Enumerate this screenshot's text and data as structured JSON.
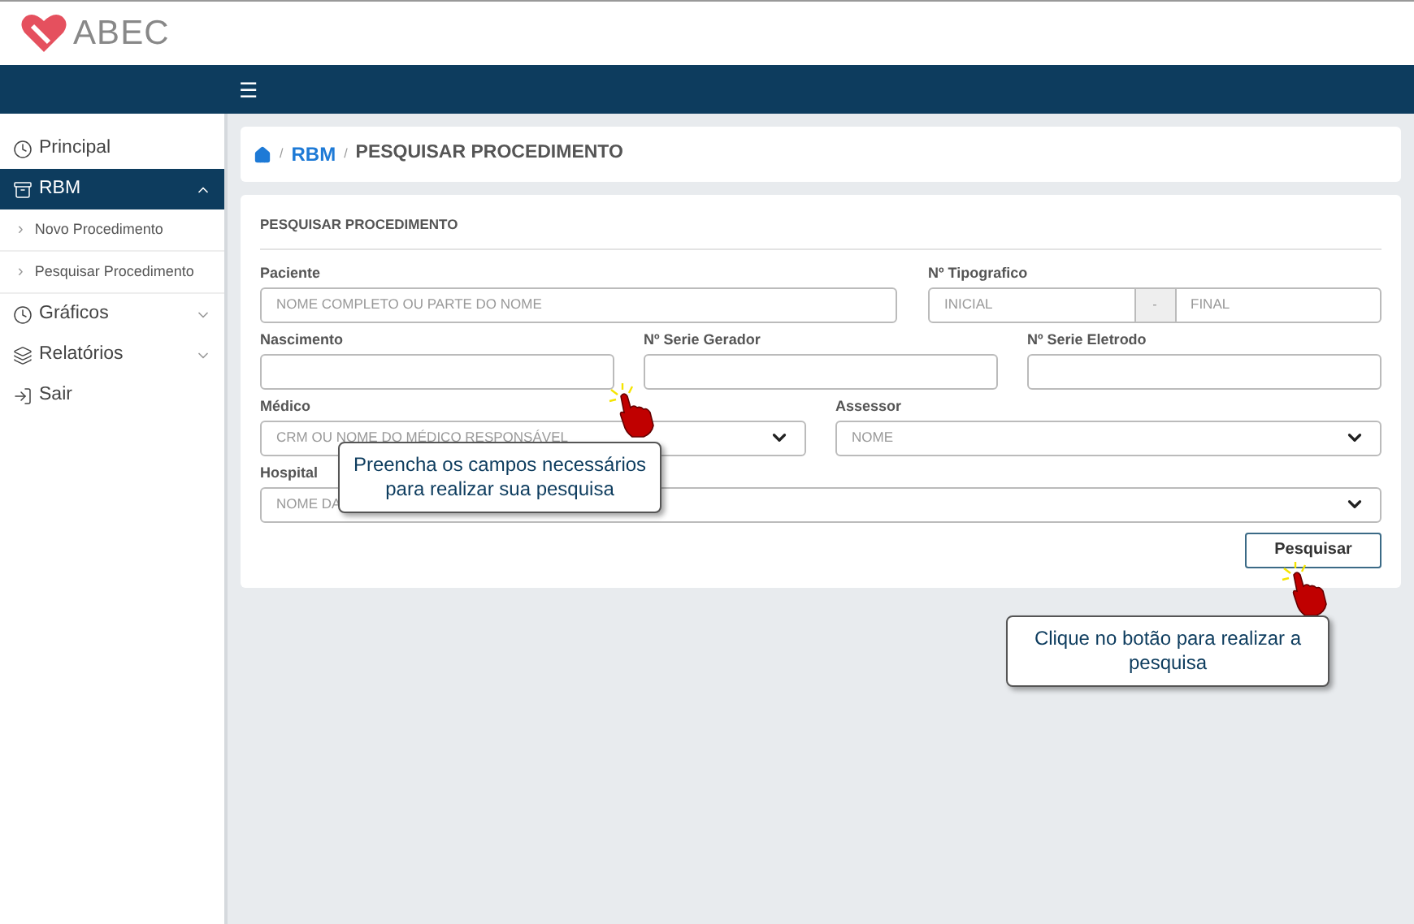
{
  "logo": {
    "text": "ABEC"
  },
  "topbar": {
    "menu_glyph": "☰"
  },
  "sidebar": {
    "items": [
      {
        "label": "Principal",
        "selected": false
      },
      {
        "label": "RBM",
        "selected": true,
        "expanded": true,
        "children": [
          {
            "label": "Novo Procedimento",
            "marker": "›"
          },
          {
            "label": "Pesquisar Procedimento",
            "marker": "›"
          }
        ]
      },
      {
        "label": "Gráficos",
        "selected": false,
        "expanded": false
      },
      {
        "label": "Relatórios",
        "selected": false,
        "expanded": false
      },
      {
        "label": "Sair",
        "selected": false
      }
    ]
  },
  "breadcrumb": {
    "separator": "/",
    "link": "RBM",
    "current": "PESQUISAR PROCEDIMENTO"
  },
  "form": {
    "title": "PESQUISAR PROCEDIMENTO",
    "paciente": {
      "label": "Paciente",
      "placeholder": "NOME COMPLETO OU PARTE DO NOME"
    },
    "tipografico": {
      "label": "Nº Tipografico",
      "from_placeholder": "INICIAL",
      "separator": "-",
      "to_placeholder": "FINAL"
    },
    "nascimento": {
      "label": "Nascimento"
    },
    "serie_gerador": {
      "label": "Nº Serie Gerador"
    },
    "serie_eletrodo": {
      "label": "Nº Serie Eletrodo"
    },
    "medico": {
      "label": "Médico",
      "placeholder": "CRM OU NOME DO MÉDICO RESPONSÁVEL"
    },
    "assessor": {
      "label": "Assessor",
      "placeholder": "NOME"
    },
    "hospital": {
      "label": "Hospital",
      "placeholder": "NOME DA"
    },
    "submit": "Pesquisar"
  },
  "callouts": [
    {
      "text": "Preencha os campos necessários para realizar sua pesquisa"
    },
    {
      "text": "Clique no botão para realizar a pesquisa"
    }
  ]
}
